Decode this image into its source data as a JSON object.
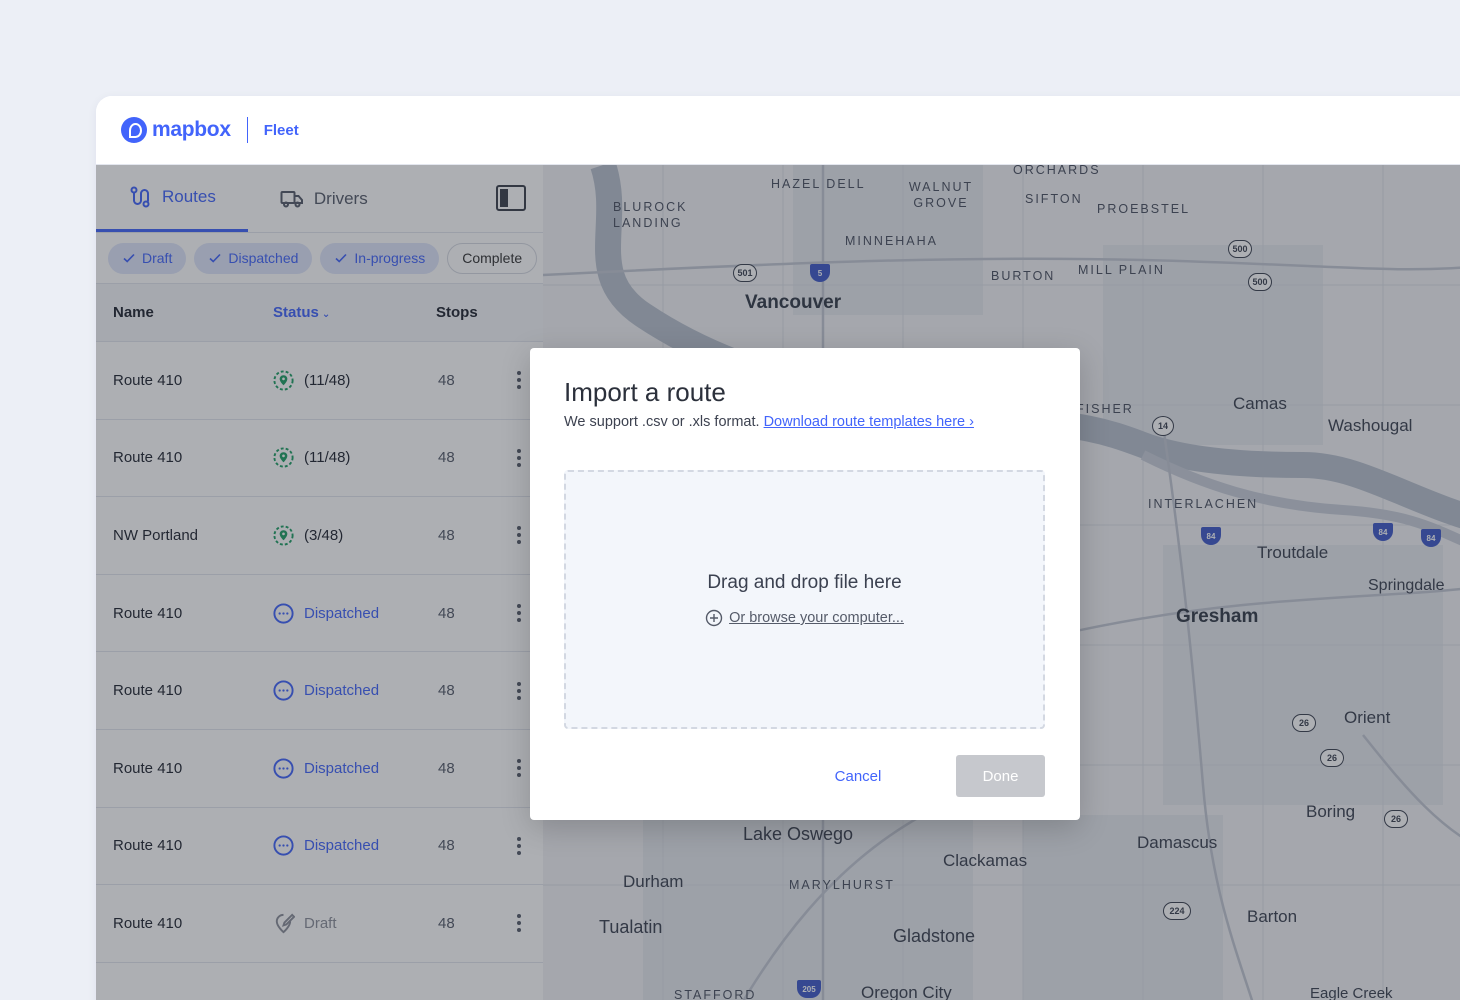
{
  "topbar": {
    "logo_text": "mapbox",
    "product": "Fleet"
  },
  "sidebar": {
    "tabs": [
      {
        "label": "Routes",
        "icon": "route-icon",
        "active": true
      },
      {
        "label": "Drivers",
        "icon": "truck-icon",
        "active": false
      }
    ],
    "filters": [
      {
        "label": "Draft",
        "selected": true
      },
      {
        "label": "Dispatched",
        "selected": true
      },
      {
        "label": "In-progress",
        "selected": true
      },
      {
        "label": "Complete",
        "selected": false
      }
    ],
    "columns": {
      "name": "Name",
      "status": "Status",
      "stops": "Stops"
    },
    "rows": [
      {
        "name": "Route 410",
        "status": "(11/48)",
        "status_type": "in-progress",
        "stops": "48"
      },
      {
        "name": "Route 410",
        "status": "(11/48)",
        "status_type": "in-progress",
        "stops": "48"
      },
      {
        "name": "NW Portland",
        "status": "(3/48)",
        "status_type": "in-progress",
        "stops": "48"
      },
      {
        "name": "Route 410",
        "status": "Dispatched",
        "status_type": "dispatched",
        "stops": "48"
      },
      {
        "name": "Route 410",
        "status": "Dispatched",
        "status_type": "dispatched",
        "stops": "48"
      },
      {
        "name": "Route 410",
        "status": "Dispatched",
        "status_type": "dispatched",
        "stops": "48"
      },
      {
        "name": "Route 410",
        "status": "Dispatched",
        "status_type": "dispatched",
        "stops": "48"
      },
      {
        "name": "Route 410",
        "status": "Draft",
        "status_type": "draft",
        "stops": "48"
      }
    ]
  },
  "map": {
    "places": [
      {
        "name": "Vancouver",
        "size": "big"
      },
      {
        "name": "Gresham",
        "size": "big"
      },
      {
        "name": "Camas",
        "size": "med"
      },
      {
        "name": "Washougal",
        "size": "med"
      },
      {
        "name": "Troutdale",
        "size": "med"
      },
      {
        "name": "Springdale",
        "size": "med"
      },
      {
        "name": "Orient",
        "size": "med"
      },
      {
        "name": "Boring",
        "size": "med"
      },
      {
        "name": "Damascus",
        "size": "med"
      },
      {
        "name": "Clackamas",
        "size": "med"
      },
      {
        "name": "Lake Oswego",
        "size": "med"
      },
      {
        "name": "Durham",
        "size": "med"
      },
      {
        "name": "Tualatin",
        "size": "med"
      },
      {
        "name": "Gladstone",
        "size": "med"
      },
      {
        "name": "Barton",
        "size": "med"
      },
      {
        "name": "Oregon City",
        "size": "med"
      },
      {
        "name": "Eagle Creek",
        "size": "med"
      },
      {
        "name": "HAZEL DELL",
        "size": "small"
      },
      {
        "name": "WALNUT GROVE",
        "size": "small"
      },
      {
        "name": "ORCHARDS",
        "size": "small"
      },
      {
        "name": "SIFTON",
        "size": "small"
      },
      {
        "name": "PROEBSTEL",
        "size": "small"
      },
      {
        "name": "BLUROCK LANDING",
        "size": "small"
      },
      {
        "name": "MINNEHAHA",
        "size": "small"
      },
      {
        "name": "BURTON",
        "size": "small"
      },
      {
        "name": "MILL PLAIN",
        "size": "small"
      },
      {
        "name": "FISHER",
        "size": "small"
      },
      {
        "name": "INTERLACHEN",
        "size": "small"
      },
      {
        "name": "MARYLHURST",
        "size": "small"
      },
      {
        "name": "STAFFORD",
        "size": "small"
      }
    ],
    "shields": [
      "501",
      "500",
      "500",
      "14",
      "26",
      "26",
      "26",
      "224"
    ],
    "interstates": [
      "5",
      "84",
      "84",
      "84",
      "205"
    ]
  },
  "modal": {
    "title": "Import a route",
    "subtitle": "We support .csv or .xls format.",
    "template_link": "Download route templates here ›",
    "dropzone_title": "Drag and drop file here",
    "browse_link": "Or browse your computer...",
    "cancel_label": "Cancel",
    "done_label": "Done"
  },
  "colors": {
    "accent": "#4264fb",
    "in_progress": "#1e9e64",
    "draft": "#8b8f99",
    "done_disabled": "#c6c8cd"
  }
}
